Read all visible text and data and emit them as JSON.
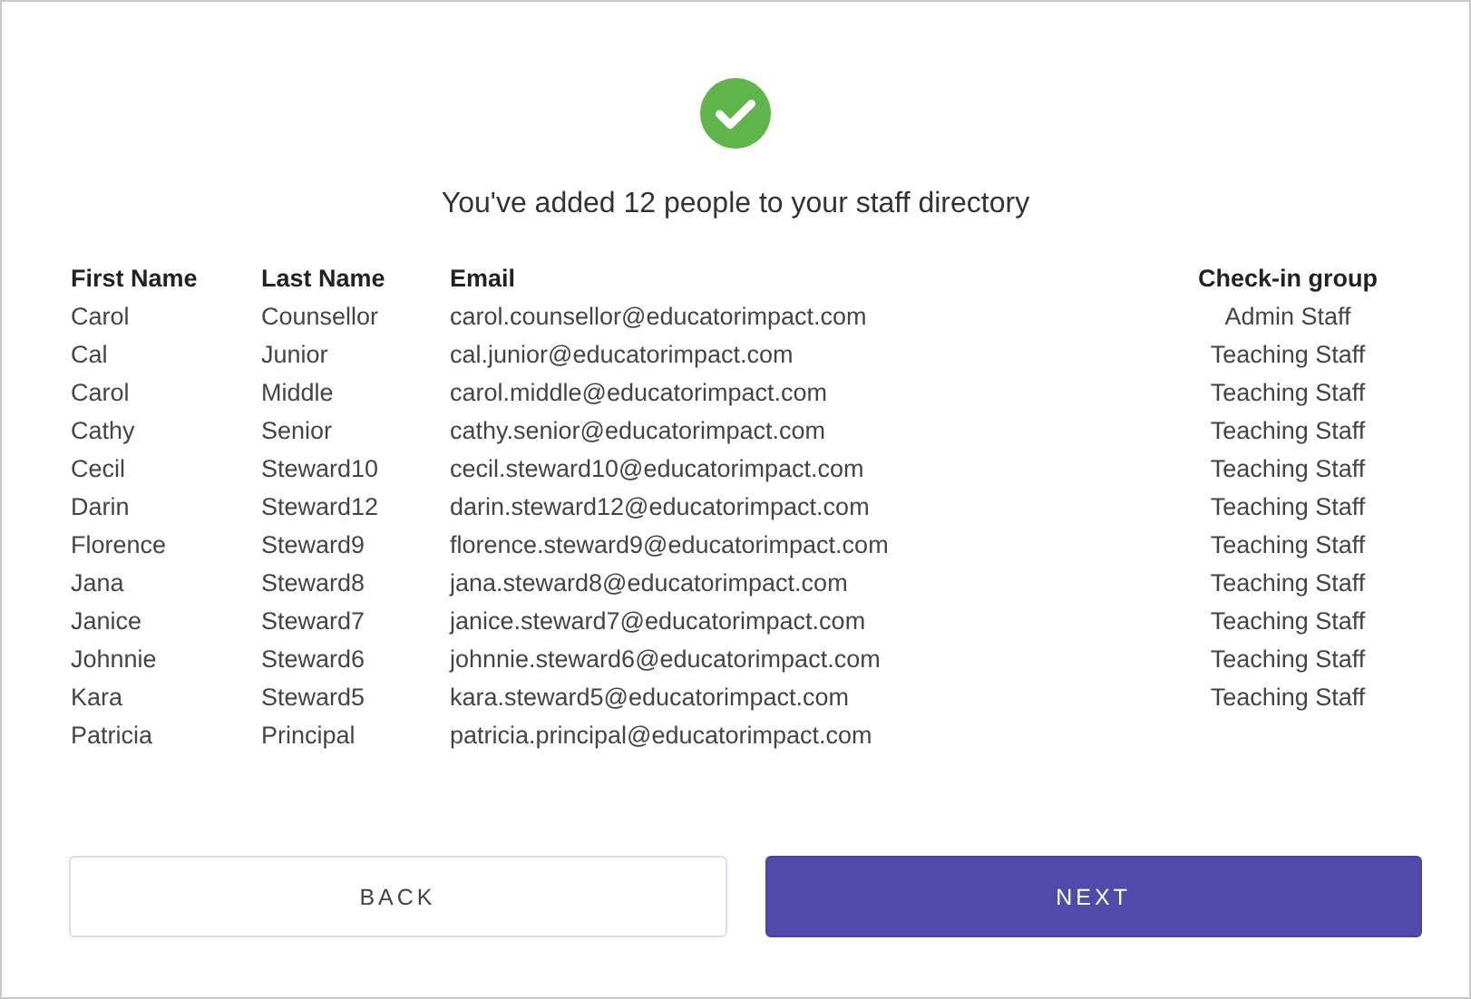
{
  "dialog": {
    "title": "You've added 12 people to your staff directory"
  },
  "table": {
    "columns": [
      "First Name",
      "Last Name",
      "Email",
      "Check-in group"
    ],
    "rows": [
      {
        "first_name": "Carol",
        "last_name": "Counsellor",
        "email": "carol.counsellor@educatorimpact.com",
        "group": "Admin Staff"
      },
      {
        "first_name": "Cal",
        "last_name": "Junior",
        "email": "cal.junior@educatorimpact.com",
        "group": "Teaching Staff"
      },
      {
        "first_name": "Carol",
        "last_name": "Middle",
        "email": "carol.middle@educatorimpact.com",
        "group": "Teaching Staff"
      },
      {
        "first_name": "Cathy",
        "last_name": "Senior",
        "email": "cathy.senior@educatorimpact.com",
        "group": "Teaching Staff"
      },
      {
        "first_name": "Cecil",
        "last_name": "Steward10",
        "email": "cecil.steward10@educatorimpact.com",
        "group": "Teaching Staff"
      },
      {
        "first_name": "Darin",
        "last_name": "Steward12",
        "email": "darin.steward12@educatorimpact.com",
        "group": "Teaching Staff"
      },
      {
        "first_name": "Florence",
        "last_name": "Steward9",
        "email": "florence.steward9@educatorimpact.com",
        "group": "Teaching Staff"
      },
      {
        "first_name": "Jana",
        "last_name": "Steward8",
        "email": "jana.steward8@educatorimpact.com",
        "group": "Teaching Staff"
      },
      {
        "first_name": "Janice",
        "last_name": "Steward7",
        "email": "janice.steward7@educatorimpact.com",
        "group": "Teaching Staff"
      },
      {
        "first_name": "Johnnie",
        "last_name": "Steward6",
        "email": "johnnie.steward6@educatorimpact.com",
        "group": "Teaching Staff"
      },
      {
        "first_name": "Kara",
        "last_name": "Steward5",
        "email": "kara.steward5@educatorimpact.com",
        "group": "Teaching Staff"
      },
      {
        "first_name": "Patricia",
        "last_name": "Principal",
        "email": "patricia.principal@educatorimpact.com"
      }
    ]
  },
  "buttons": [
    {
      "label": "BACK",
      "kind": "secondary"
    },
    {
      "label": "NEXT",
      "kind": "primary"
    }
  ]
}
